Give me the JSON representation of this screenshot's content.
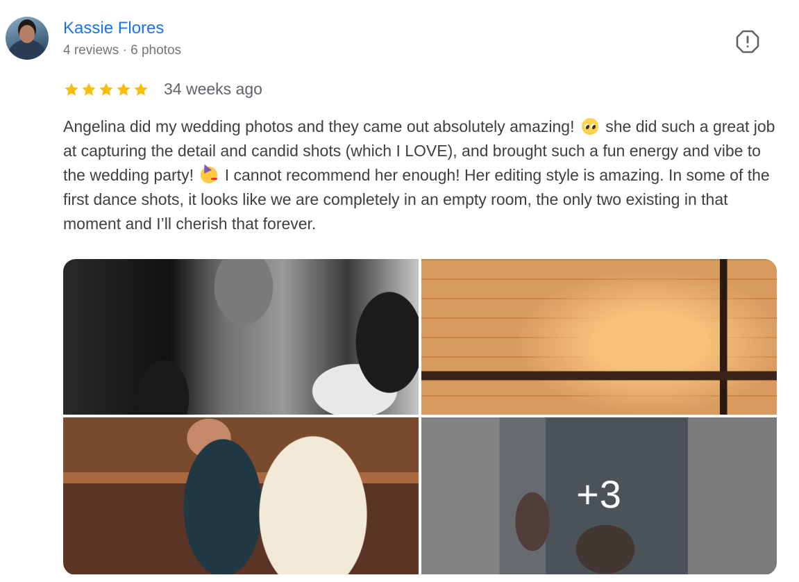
{
  "reviewer": {
    "name": "Kassie Flores",
    "meta": "4 reviews · 6 photos"
  },
  "review": {
    "rating": 5,
    "max_rating": 5,
    "star_color": "#fbbc04",
    "timestamp": "34 weeks ago",
    "text_part1": "Angelina did my wedding photos and they came out absolutely amazing!",
    "emoji1": "pleading-face-emoji",
    "text_part2": "she did such a great job at capturing the detail and candid shots (which I LOVE), and brought such a fun energy and vibe to the wedding party!",
    "emoji2": "partying-face-emoji",
    "text_part3": "I cannot recommend her enough! Her editing style is amazing. In some of the first dance shots, it looks like we are completely in an empty room, the only two existing in that moment and I’ll cherish that forever."
  },
  "photos": {
    "more_count": "+3"
  },
  "colors": {
    "name": "#1a73e8",
    "meta": "#70757a",
    "body_text": "#3c4043"
  },
  "icons": {
    "report": "report-flag-icon",
    "star": "star-icon"
  }
}
